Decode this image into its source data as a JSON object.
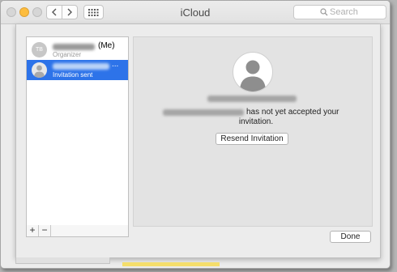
{
  "window": {
    "title": "iCloud"
  },
  "toolbar": {
    "search_placeholder": "Search",
    "icons": {
      "back": "chevron-left-icon",
      "forward": "chevron-right-icon",
      "grid": "show-all-grid-icon",
      "search": "search-icon"
    }
  },
  "members": [
    {
      "initials": "TB",
      "name_suffix": "(Me)",
      "role": "Organizer",
      "selected": false
    },
    {
      "initials": "",
      "name_suffix": "...",
      "role": "Invitation sent",
      "selected": true
    }
  ],
  "detail": {
    "status_text": "has not yet accepted your",
    "status_text_2": "invitation.",
    "resend_label": "Resend Invitation"
  },
  "list_toolbar": {
    "add_label": "+",
    "remove_label": "−"
  },
  "footer": {
    "done_label": "Done"
  },
  "colors": {
    "selection": "#2d73e9",
    "minimize": "#fdbd3e"
  }
}
